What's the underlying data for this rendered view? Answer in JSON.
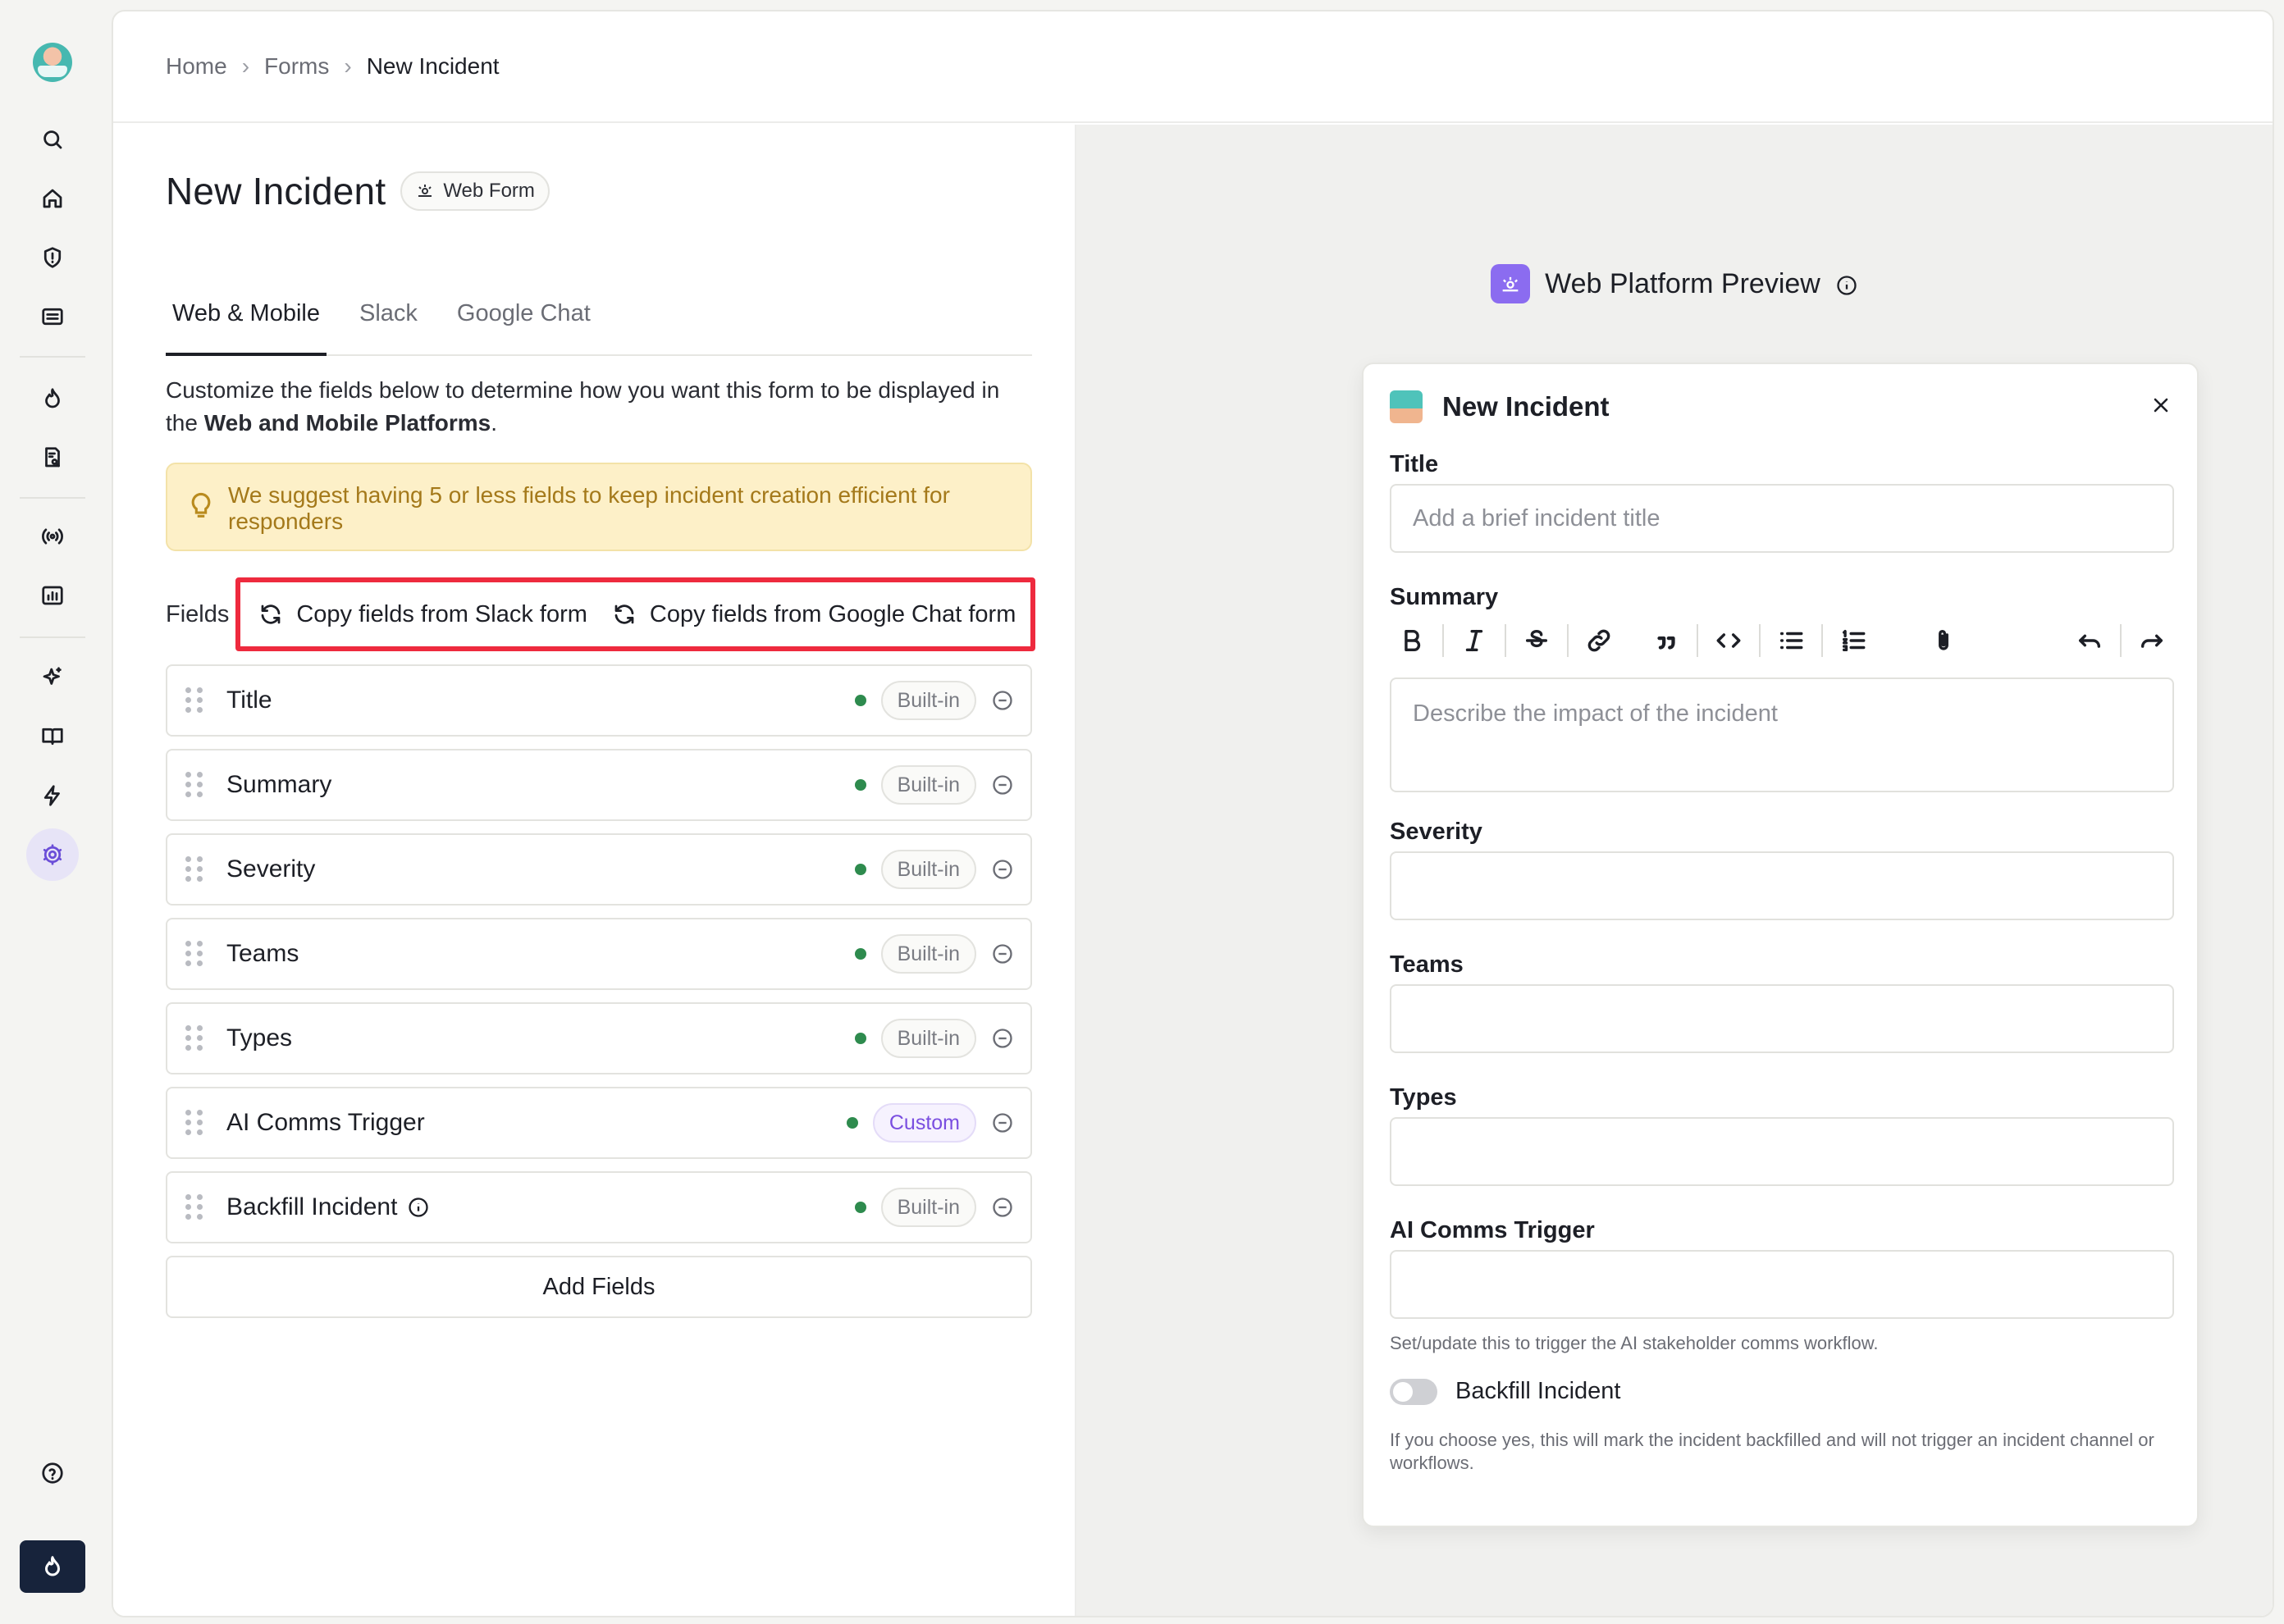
{
  "breadcrumb": {
    "home": "Home",
    "forms": "Forms",
    "current": "New Incident",
    "separator": "›"
  },
  "page": {
    "title": "New Incident",
    "badge": "Web Form"
  },
  "tabs": [
    {
      "label": "Web & Mobile",
      "active": true
    },
    {
      "label": "Slack",
      "active": false
    },
    {
      "label": "Google Chat",
      "active": false
    }
  ],
  "description": {
    "prefix": "Customize the fields below to determine how you want this form to be displayed in the ",
    "bold": "Web and Mobile Platforms",
    "suffix": "."
  },
  "hint": {
    "text": "We suggest having 5 or less fields to keep incident creation efficient for responders",
    "color": "#a4791a"
  },
  "fields_section": {
    "label": "Fields",
    "copy_slack": "Copy fields from Slack form",
    "copy_google_chat": "Copy fields from Google Chat form"
  },
  "fields": [
    {
      "name": "Title",
      "tag": "Built-in",
      "info": false
    },
    {
      "name": "Summary",
      "tag": "Built-in",
      "info": false
    },
    {
      "name": "Severity",
      "tag": "Built-in",
      "info": false
    },
    {
      "name": "Teams",
      "tag": "Built-in",
      "info": false
    },
    {
      "name": "Types",
      "tag": "Built-in",
      "info": false
    },
    {
      "name": "AI Comms Trigger",
      "tag": "Custom",
      "info": false
    },
    {
      "name": "Backfill Incident",
      "tag": "Built-in",
      "info": true
    }
  ],
  "add_fields_label": "Add Fields",
  "preview": {
    "heading": "Web Platform Preview",
    "modal_title": "New Incident",
    "title_label": "Title",
    "title_placeholder": "Add a brief incident title",
    "summary_label": "Summary",
    "summary_placeholder": "Describe the impact of the incident",
    "severity_label": "Severity",
    "teams_label": "Teams",
    "types_label": "Types",
    "ai_label": "AI Comms Trigger",
    "ai_help": "Set/update this to trigger the AI stakeholder comms workflow.",
    "backfill_label": "Backfill Incident",
    "backfill_help": "If you choose yes, this will mark the incident backfilled and will not trigger an incident channel or workflows.",
    "toolbar": [
      "bold-icon",
      "italic-icon",
      "strikethrough-icon",
      "link-icon",
      "quote-icon",
      "code-icon",
      "bullet-list-icon",
      "numbered-list-icon",
      "attachment-icon",
      "undo-icon",
      "redo-icon"
    ]
  },
  "rail": {
    "items": [
      "search-icon",
      "home-icon",
      "incident-shield-icon",
      "dashboard-icon",
      "fire-icon",
      "runbook-icon",
      "signal-icon",
      "analytics-icon",
      "sparkle-icon",
      "book-icon",
      "lightning-icon",
      "settings-icon",
      "help-icon"
    ]
  },
  "colors": {
    "accent": "#6b4ed8",
    "highlight_border": "#ee2a3e",
    "status_dot": "#2e8b4e",
    "rail_bottom": "#17233b"
  }
}
